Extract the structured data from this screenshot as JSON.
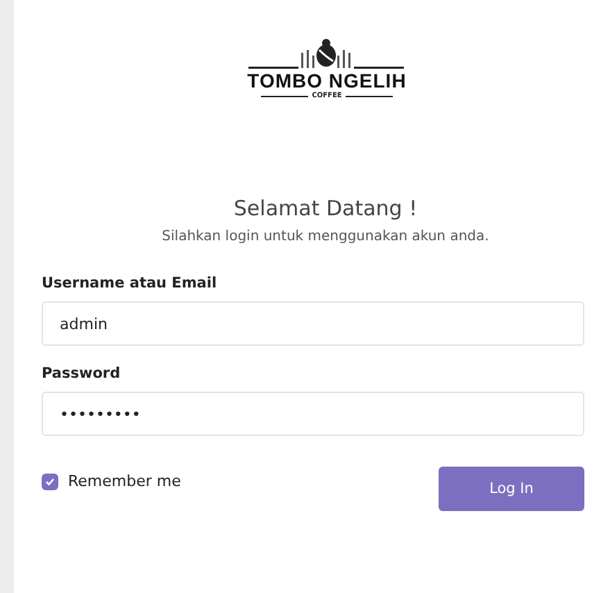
{
  "logo": {
    "name": "TOMBO NGELIH",
    "tagline": "COFFEE"
  },
  "heading": "Selamat Datang !",
  "subheading": "Silahkan login untuk menggunakan akun anda.",
  "fields": [
    {
      "label": "Username atau Email",
      "value": "admin"
    },
    {
      "label": "Password",
      "value": "•••••••••"
    }
  ],
  "remember": {
    "label": "Remember me",
    "checked": true
  },
  "submit": "Log In"
}
